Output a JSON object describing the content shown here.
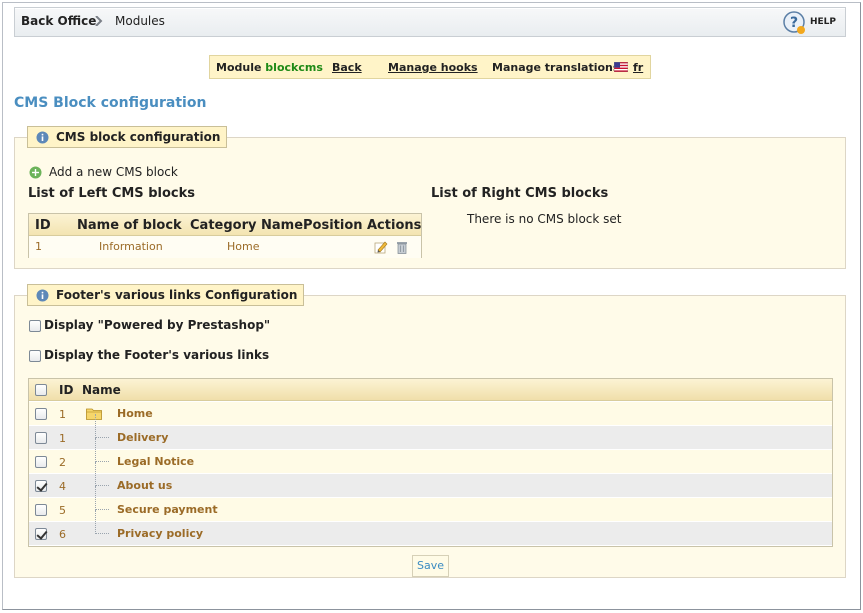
{
  "breadcrumb": {
    "home": "Back Office",
    "current": "Modules"
  },
  "help": {
    "label": "HELP"
  },
  "module_toolbar": {
    "module_prefix": "Module",
    "module_name": "blockcms",
    "back": "Back",
    "manage_hooks": "Manage hooks",
    "manage_translations": "Manage translations:",
    "lang": "fr"
  },
  "page_title": "CMS Block configuration",
  "cms_section": {
    "legend": "CMS block configuration",
    "add_new": "Add a new CMS block",
    "left_title": "List of Left CMS blocks",
    "right_title": "List of Right CMS blocks",
    "right_empty": "There is no CMS block set",
    "columns": [
      "ID",
      "Name of block",
      "Category Name",
      "Position",
      "Actions"
    ],
    "rows": [
      {
        "id": "1",
        "name": "Information",
        "category": "Home",
        "position": ""
      }
    ]
  },
  "footer_section": {
    "legend": "Footer's various links Configuration",
    "powered_label": "Display \"Powered by Prestashop\"",
    "powered_checked": false,
    "various_label": "Display the Footer's various links",
    "various_checked": false,
    "columns": [
      "ID",
      "Name"
    ],
    "rows": [
      {
        "id": "1",
        "name": "Home",
        "checked": false
      },
      {
        "id": "1",
        "name": "Delivery",
        "checked": false
      },
      {
        "id": "2",
        "name": "Legal Notice",
        "checked": false
      },
      {
        "id": "4",
        "name": "About us",
        "checked": true
      },
      {
        "id": "5",
        "name": "Secure payment",
        "checked": false
      },
      {
        "id": "6",
        "name": "Privacy policy",
        "checked": true
      }
    ],
    "save_label": "Save"
  },
  "colors": {
    "title_blue": "#4a8ec0",
    "module_green": "#1e8a16",
    "link_brown": "#9b6b27"
  }
}
